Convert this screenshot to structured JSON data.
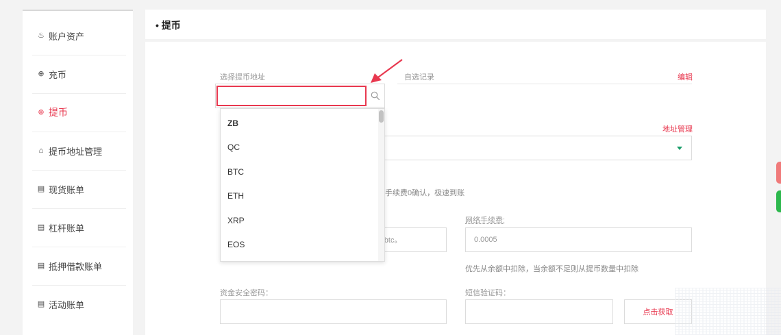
{
  "sidebar": {
    "items": [
      {
        "label": "账户资产",
        "icon": "assets-icon",
        "glyph": "♨"
      },
      {
        "label": "充币",
        "icon": "deposit-icon",
        "glyph": "⊕"
      },
      {
        "label": "提币",
        "icon": "withdraw-icon",
        "glyph": "⊕",
        "active": true
      },
      {
        "label": "提币地址管理",
        "icon": "address-book-icon",
        "glyph": "⌂"
      },
      {
        "label": "现货账单",
        "icon": "bill-icon",
        "glyph": "▤"
      },
      {
        "label": "杠杆账单",
        "icon": "bill-icon",
        "glyph": "▤"
      },
      {
        "label": "抵押借款账单",
        "icon": "bill-icon",
        "glyph": "▤"
      },
      {
        "label": "活动账单",
        "icon": "bill-icon",
        "glyph": "▤"
      }
    ]
  },
  "header": {
    "title": "• 提币"
  },
  "form": {
    "select_address_label": "选择提币地址",
    "custom_record_label": "自选记录",
    "edit_label": "编辑",
    "address_manage_label": "地址管理",
    "fee_note_partial": "手续费0确认，极速到账",
    "amount_hint_partial": ")1btc。",
    "network_fee_label": "网络手续费:",
    "network_fee_value": "0.0005",
    "deduct_note": "优先从余额中扣除，当余额不足则从提币数量中扣除",
    "fund_password_label": "资金安全密码：",
    "sms_code_label": "短信验证码：",
    "get_code_button": "点击获取"
  },
  "dropdown": {
    "search_value": "",
    "options": [
      "ZB",
      "QC",
      "BTC",
      "ETH",
      "XRP",
      "EOS"
    ],
    "highlighted": "ZB"
  },
  "colors": {
    "accent_red": "#e8384f",
    "select_caret": "#1a9d6a",
    "pill_red": "#f07a7a",
    "pill_green": "#2db84d"
  }
}
